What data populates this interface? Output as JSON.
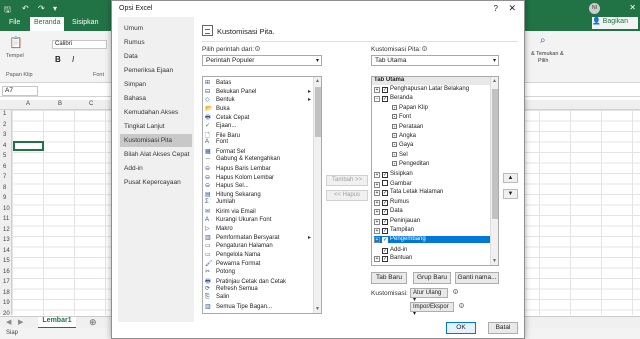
{
  "excel": {
    "tabs": [
      "File",
      "Beranda",
      "Sisipkan"
    ],
    "share_label": "Bagikan",
    "find_label_1": "& Temukan &",
    "find_label_2": "Pilih",
    "ribbon": {
      "paste_label": "Tempel",
      "clipboard_label": "Papan Klip",
      "font_name": "Calibri",
      "font_group_label": "Font"
    },
    "name_box": "A7",
    "columns": [
      "A",
      "B",
      "C"
    ],
    "rows": [
      "1",
      "2",
      "3",
      "4",
      "5",
      "6",
      "7",
      "8",
      "9",
      "10",
      "11",
      "12",
      "13",
      "14",
      "15",
      "16",
      "17",
      "18",
      "19",
      "20",
      "21"
    ],
    "sheet_tab": "Lembar1",
    "status": "Siap",
    "avatar": "NI"
  },
  "dialog": {
    "title": "Opsi Excel",
    "help": "?",
    "close": "✕",
    "categories": [
      "Umum",
      "Rumus",
      "Data",
      "Pemeriksa Ejaan",
      "Simpan",
      "Bahasa",
      "Kemudahan Akses",
      "Tingkat Lanjut",
      "Kustomisasi Pita",
      "Bilah Alat Akses Cepat",
      "Add-in",
      "Pusat Kepercayaan"
    ],
    "active_category": "Kustomisasi Pita",
    "header": "Kustomisasi Pita.",
    "left": {
      "label": "Pilih perintah dari:",
      "combo_value": "Perintah Populer",
      "commands": [
        "Batas",
        "Bekukan Panel",
        "Bentuk",
        "Buka",
        "Cetak Cepat",
        "Ejaan...",
        "File Baru",
        "Font",
        "Format Sel",
        "Gabung & Ketengahkan",
        "Hapus Baris Lembar",
        "Hapus Kolom Lembar",
        "Hapus Sel...",
        "Hitung Sekarang",
        "Jumlah",
        "Kirim via Email",
        "Kurangi Ukuran Font",
        "Makro",
        "Pemformatan Bersyarat",
        "Pengaturan Halaman",
        "Pengelola Nama",
        "Pewarna Format",
        "Potong",
        "Pratinjau Cetak dan Cetak",
        "Refresh Semua",
        "Salin",
        "Semua Tipe Bagan..."
      ]
    },
    "middle": {
      "add_label": "Tambah >>",
      "remove_label": "<< Hapus"
    },
    "right": {
      "label": "Kustomisasi Pita:",
      "combo_value": "Tab Utama",
      "tree_header": "Tab Utama",
      "tree": [
        {
          "label": "Penghapusan Latar Belakang",
          "level": 1,
          "expand": "+",
          "checked": true
        },
        {
          "label": "Beranda",
          "level": 1,
          "expand": "−",
          "checked": true
        },
        {
          "label": "Papan Klip",
          "level": 2,
          "expand": "+"
        },
        {
          "label": "Font",
          "level": 2,
          "expand": "+"
        },
        {
          "label": "Perataan",
          "level": 2,
          "expand": "+"
        },
        {
          "label": "Angka",
          "level": 2,
          "expand": "+"
        },
        {
          "label": "Gaya",
          "level": 2,
          "expand": "+"
        },
        {
          "label": "Sel",
          "level": 2,
          "expand": "+"
        },
        {
          "label": "Pengeditan",
          "level": 2,
          "expand": "+"
        },
        {
          "label": "Sisipkan",
          "level": 1,
          "expand": "+",
          "checked": true
        },
        {
          "label": "Gambar",
          "level": 1,
          "expand": "+",
          "checked": false
        },
        {
          "label": "Tata Letak Halaman",
          "level": 1,
          "expand": "+",
          "checked": true
        },
        {
          "label": "Rumus",
          "level": 1,
          "expand": "+",
          "checked": true
        },
        {
          "label": "Data",
          "level": 1,
          "expand": "+",
          "checked": true
        },
        {
          "label": "Peninjauan",
          "level": 1,
          "expand": "+",
          "checked": true
        },
        {
          "label": "Tampilan",
          "level": 1,
          "expand": "+",
          "checked": true
        },
        {
          "label": "Pengembang",
          "level": 1,
          "expand": "+",
          "checked": true,
          "selected": true
        },
        {
          "label": "Add-in",
          "level": 1,
          "expand": "",
          "checked": true
        },
        {
          "label": "Bantuan",
          "level": 1,
          "expand": "+",
          "checked": true
        }
      ],
      "new_tab": "Tab Baru",
      "new_group": "Grup Baru",
      "rename": "Ganti nama...",
      "custom_label": "Kustomisasi:",
      "reset_label": "Atur Ulang",
      "import_export": "Impor/Ekspor"
    },
    "ok": "OK",
    "cancel": "Batal"
  }
}
